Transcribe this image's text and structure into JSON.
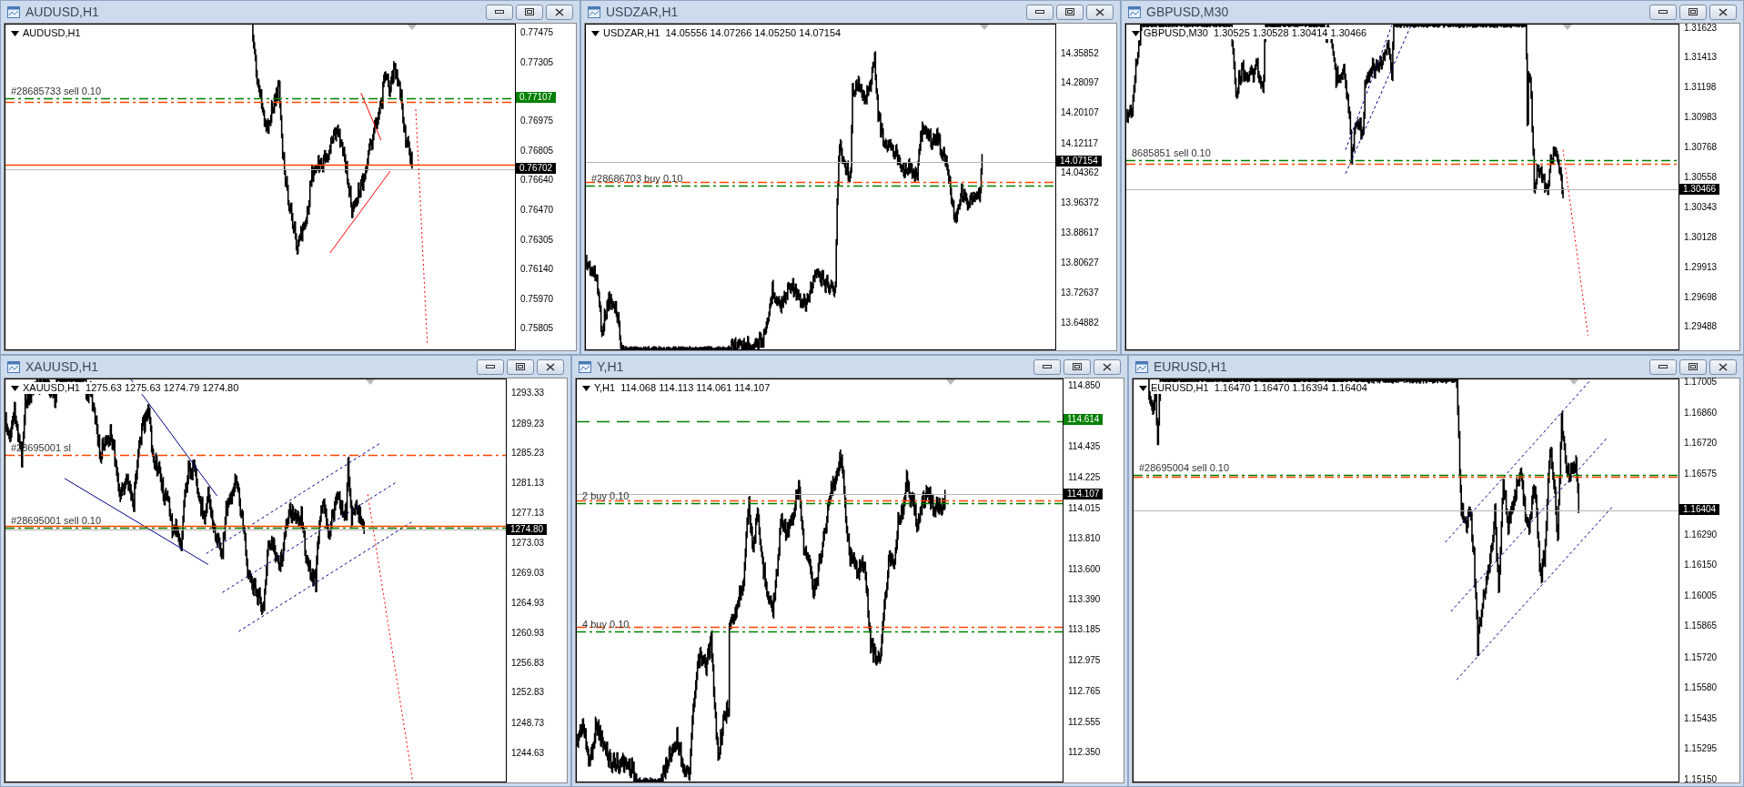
{
  "windows": [
    {
      "title": "AUDUSD,H1",
      "info": "AUDUSD,H1",
      "orders": [
        {
          "label": "#28685733 sell 0.10",
          "kind": "entry"
        },
        {
          "kind": "sl"
        },
        {
          "kind": "level"
        }
      ],
      "price_axis": {
        "ticks": [
          "0.77475",
          "0.77305",
          "0.76975",
          "0.76805",
          "0.76640",
          "0.76470",
          "0.76305",
          "0.76140",
          "0.75970",
          "0.75805"
        ],
        "labels": [
          {
            "text": "0.77107",
            "kind": "order"
          },
          {
            "text": "0.76702",
            "kind": "current"
          }
        ]
      }
    },
    {
      "title": "USDZAR,H1",
      "info": "USDZAR,H1  14.05556 14.07266 14.05250 14.07154",
      "orders": [
        {
          "kind": "sl"
        },
        {
          "label": "#28686703 buy 0.10",
          "kind": "entry"
        }
      ],
      "price_axis": {
        "ticks": [
          "14.35852",
          "14.28097",
          "14.20107",
          "14.12117",
          "14.04362",
          "13.96372",
          "13.88617",
          "13.80627",
          "13.72637",
          "13.64882"
        ],
        "labels": [
          {
            "text": "14.07154",
            "kind": "current"
          }
        ]
      }
    },
    {
      "title": "GBPUSD,M30",
      "info": "GBPUSD,M30  1.30525 1.30528 1.30414 1.30466",
      "orders": [
        {
          "label": "8685851 sell 0.10",
          "kind": "entry"
        },
        {
          "kind": "sl"
        }
      ],
      "price_axis": {
        "ticks": [
          "1.31623",
          "1.31413",
          "1.31198",
          "1.30983",
          "1.30768",
          "1.30558",
          "1.30343",
          "1.30128",
          "1.29913",
          "1.29698",
          "1.29488"
        ],
        "labels": [
          {
            "text": "1.30466",
            "kind": "current"
          }
        ]
      }
    },
    {
      "title": "XAUUSD,H1",
      "info": "XAUUSD,H1  1275.63 1275.63 1274.79 1274.80",
      "orders": [
        {
          "label": "#28695001 sl",
          "kind": "sl"
        },
        {
          "kind": "level"
        },
        {
          "label": "#28695001 sell 0.10",
          "kind": "entry"
        }
      ],
      "price_axis": {
        "ticks": [
          "1293.33",
          "1289.23",
          "1285.23",
          "1281.13",
          "1277.13",
          "1273.03",
          "1269.03",
          "1264.93",
          "1260.93",
          "1256.83",
          "1252.83",
          "1248.73",
          "1244.63"
        ],
        "labels": [
          {
            "text": "1274.80",
            "kind": "current"
          }
        ]
      }
    },
    {
      "title": "Y,H1",
      "info": "Y,H1  114.068 114.113 114.061 114.107",
      "orders": [
        {
          "kind": "tp"
        },
        {
          "kind": "sl"
        },
        {
          "label": "2 buy 0.10",
          "kind": "entry"
        },
        {
          "kind": "sl"
        },
        {
          "label": "4 buy 0.10",
          "kind": "entry"
        }
      ],
      "price_axis": {
        "ticks": [
          "114.850",
          "114.435",
          "114.225",
          "114.015",
          "113.810",
          "113.600",
          "113.390",
          "113.185",
          "112.975",
          "112.765",
          "112.555",
          "112.350"
        ],
        "labels": [
          {
            "text": "114.614",
            "kind": "order"
          },
          {
            "text": "114.107",
            "kind": "current"
          }
        ]
      }
    },
    {
      "title": "EURUSD,H1",
      "info": "EURUSD,H1  1.16470 1.16470 1.16394 1.16404",
      "orders": [
        {
          "label": "#28695004 sell 0.10",
          "kind": "entry"
        },
        {
          "kind": "sl"
        }
      ],
      "price_axis": {
        "ticks": [
          "1.17005",
          "1.16860",
          "1.16720",
          "1.16575",
          "1.16290",
          "1.16150",
          "1.16005",
          "1.15865",
          "1.15720",
          "1.15580",
          "1.15435",
          "1.15295",
          "1.15150"
        ],
        "labels": [
          {
            "text": "1.16404",
            "kind": "current"
          }
        ]
      }
    }
  ]
}
